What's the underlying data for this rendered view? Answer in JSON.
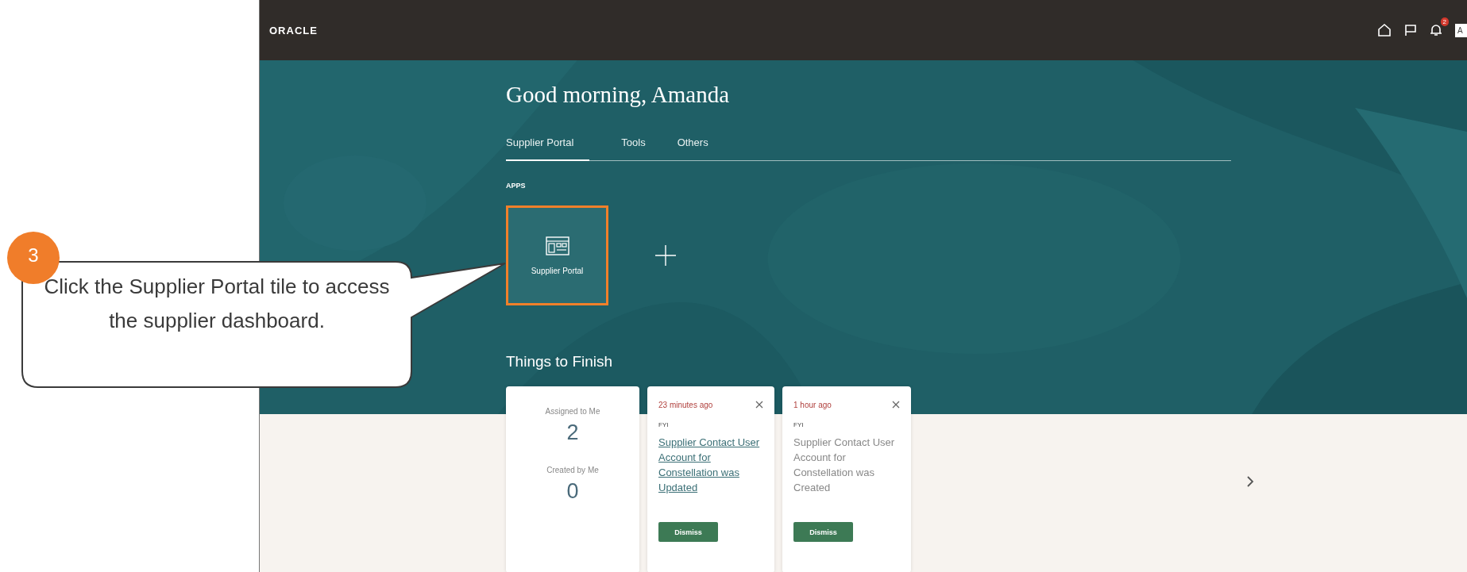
{
  "header": {
    "logo": "ORACLE",
    "notification_count": "2",
    "avatar": "A"
  },
  "greeting": "Good morning, Amanda",
  "tabs": [
    {
      "label": "Supplier Portal",
      "selected": true
    },
    {
      "label": "Tools",
      "selected": false
    },
    {
      "label": "Others",
      "selected": false
    }
  ],
  "apps_heading": "APPS",
  "apps": [
    {
      "label": "Supplier Portal",
      "highlighted": true
    }
  ],
  "things_to_finish": {
    "title": "Things to Finish",
    "summary": {
      "assigned_label": "Assigned to Me",
      "assigned_count": "2",
      "created_label": "Created by Me",
      "created_count": "0"
    },
    "items": [
      {
        "time": "23 minutes ago",
        "type": "FYI",
        "title": "Supplier Contact User Account for Constellation was Updated",
        "link": true,
        "button": "Dismiss"
      },
      {
        "time": "1 hour ago",
        "type": "FYI",
        "title": "Supplier Contact User Account for Constellation was Created",
        "link": false,
        "button": "Dismiss"
      }
    ]
  },
  "callout": {
    "step": "3",
    "text": "Click the Supplier Portal tile to access the supplier dashboard."
  }
}
